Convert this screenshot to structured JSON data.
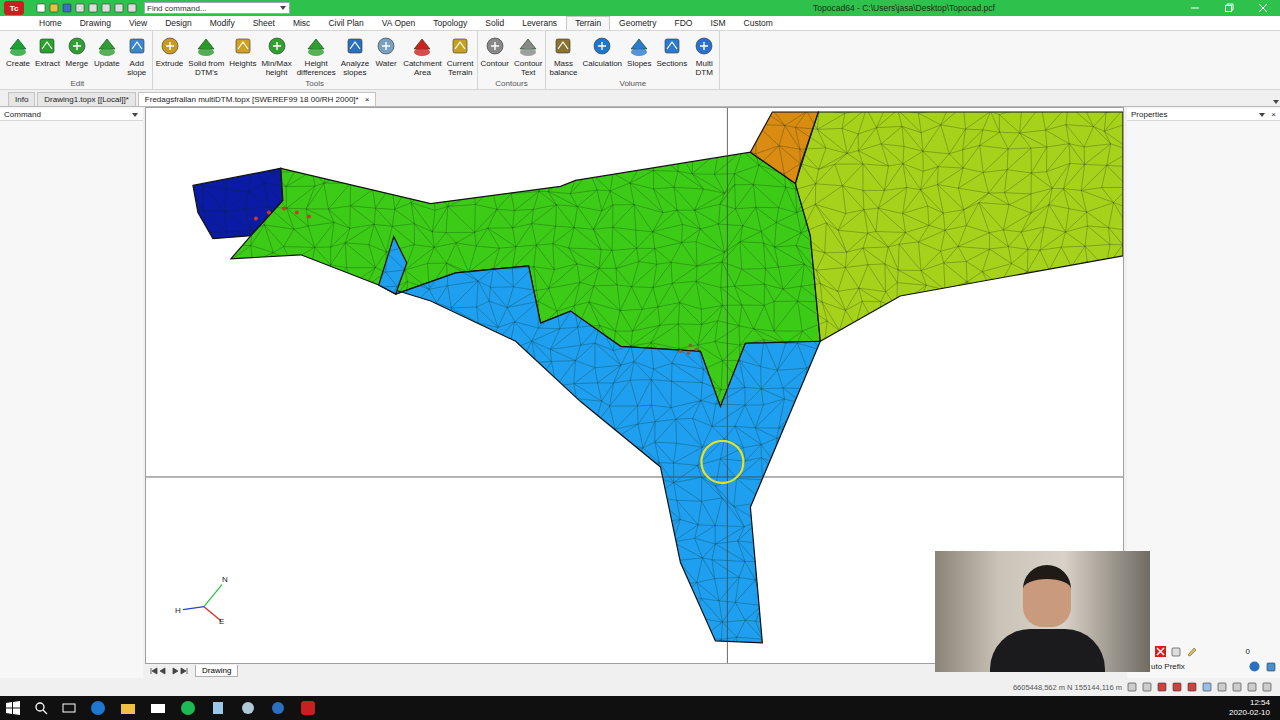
{
  "window": {
    "title": "Topocad64 - C:\\Users\\jasa\\Desktop\\Topocad.pcf",
    "app_icon": "Tc",
    "search": {
      "placeholder": "Find command..."
    }
  },
  "menu": [
    {
      "label": "Home",
      "selected": false
    },
    {
      "label": "Drawing",
      "selected": false
    },
    {
      "label": "View",
      "selected": false
    },
    {
      "label": "Design",
      "selected": false
    },
    {
      "label": "Modify",
      "selected": false
    },
    {
      "label": "Sheet",
      "selected": false
    },
    {
      "label": "Misc",
      "selected": false
    },
    {
      "label": "Civil Plan",
      "selected": false
    },
    {
      "label": "VA Open",
      "selected": false
    },
    {
      "label": "Topology",
      "selected": false
    },
    {
      "label": "Solid",
      "selected": false
    },
    {
      "label": "Leverans",
      "selected": false
    },
    {
      "label": "Terrain",
      "selected": true
    },
    {
      "label": "Geometry",
      "selected": false
    },
    {
      "label": "FDO",
      "selected": false
    },
    {
      "label": "ISM",
      "selected": false
    },
    {
      "label": "Custom",
      "selected": false
    }
  ],
  "ribbon": {
    "groups": [
      {
        "label": "Edit",
        "buttons": [
          {
            "lines": [
              "Create"
            ]
          },
          {
            "lines": [
              "Extract"
            ]
          },
          {
            "lines": [
              "Merge"
            ]
          },
          {
            "lines": [
              "Update"
            ]
          },
          {
            "lines": [
              "Add",
              "slope"
            ]
          }
        ]
      },
      {
        "label": "Tools",
        "buttons": [
          {
            "lines": [
              "Extrude"
            ]
          },
          {
            "lines": [
              "Solid from",
              "DTM's"
            ]
          },
          {
            "lines": [
              "Heights"
            ]
          },
          {
            "lines": [
              "Min/Max",
              "height"
            ]
          },
          {
            "lines": [
              "Height",
              "differences"
            ]
          },
          {
            "lines": [
              "Analyze",
              "slopes"
            ]
          },
          {
            "lines": [
              "Water"
            ]
          },
          {
            "lines": [
              "Catchment",
              "Area"
            ]
          },
          {
            "lines": [
              "Current",
              "Terrain"
            ]
          }
        ]
      },
      {
        "label": "Contours",
        "buttons": [
          {
            "lines": [
              "Contour"
            ]
          },
          {
            "lines": [
              "Contour",
              "Text"
            ]
          }
        ]
      },
      {
        "label": "Volume",
        "buttons": [
          {
            "lines": [
              "Mass",
              "balance"
            ]
          },
          {
            "lines": [
              "Calculation"
            ]
          },
          {
            "lines": [
              "Slopes"
            ]
          },
          {
            "lines": [
              "Sections"
            ]
          },
          {
            "lines": [
              "Multi",
              "DTM"
            ]
          }
        ]
      }
    ]
  },
  "documents": [
    {
      "label": "Info",
      "selected": false
    },
    {
      "label": "Drawing1.topx [[Local]]*",
      "selected": false
    },
    {
      "label": "Fredagsfrallan multiDTM.topx [SWEREF99 18 00/RH 2000]*",
      "selected": true
    }
  ],
  "close_tab": "×",
  "command_panel": {
    "title": "Command"
  },
  "properties_panel": {
    "title": "Properties",
    "close": "×",
    "count": "0",
    "prefix": "uto Prefix"
  },
  "canvas": {
    "sheet_tab": "Drawing",
    "compass": {
      "north": "N",
      "height": "H",
      "east": "E"
    },
    "surfaces": [
      {
        "color": "#0b1ba6"
      },
      {
        "color": "#3ccc17"
      },
      {
        "color": "#1f9ff0"
      },
      {
        "color": "#a7d21c"
      },
      {
        "color": "#d98b12"
      }
    ]
  },
  "status_bar": {
    "coordinates": "6605448,562 m N 155144,116 m"
  },
  "taskbar": {
    "time": "12:54",
    "date": "2020-02-10"
  }
}
